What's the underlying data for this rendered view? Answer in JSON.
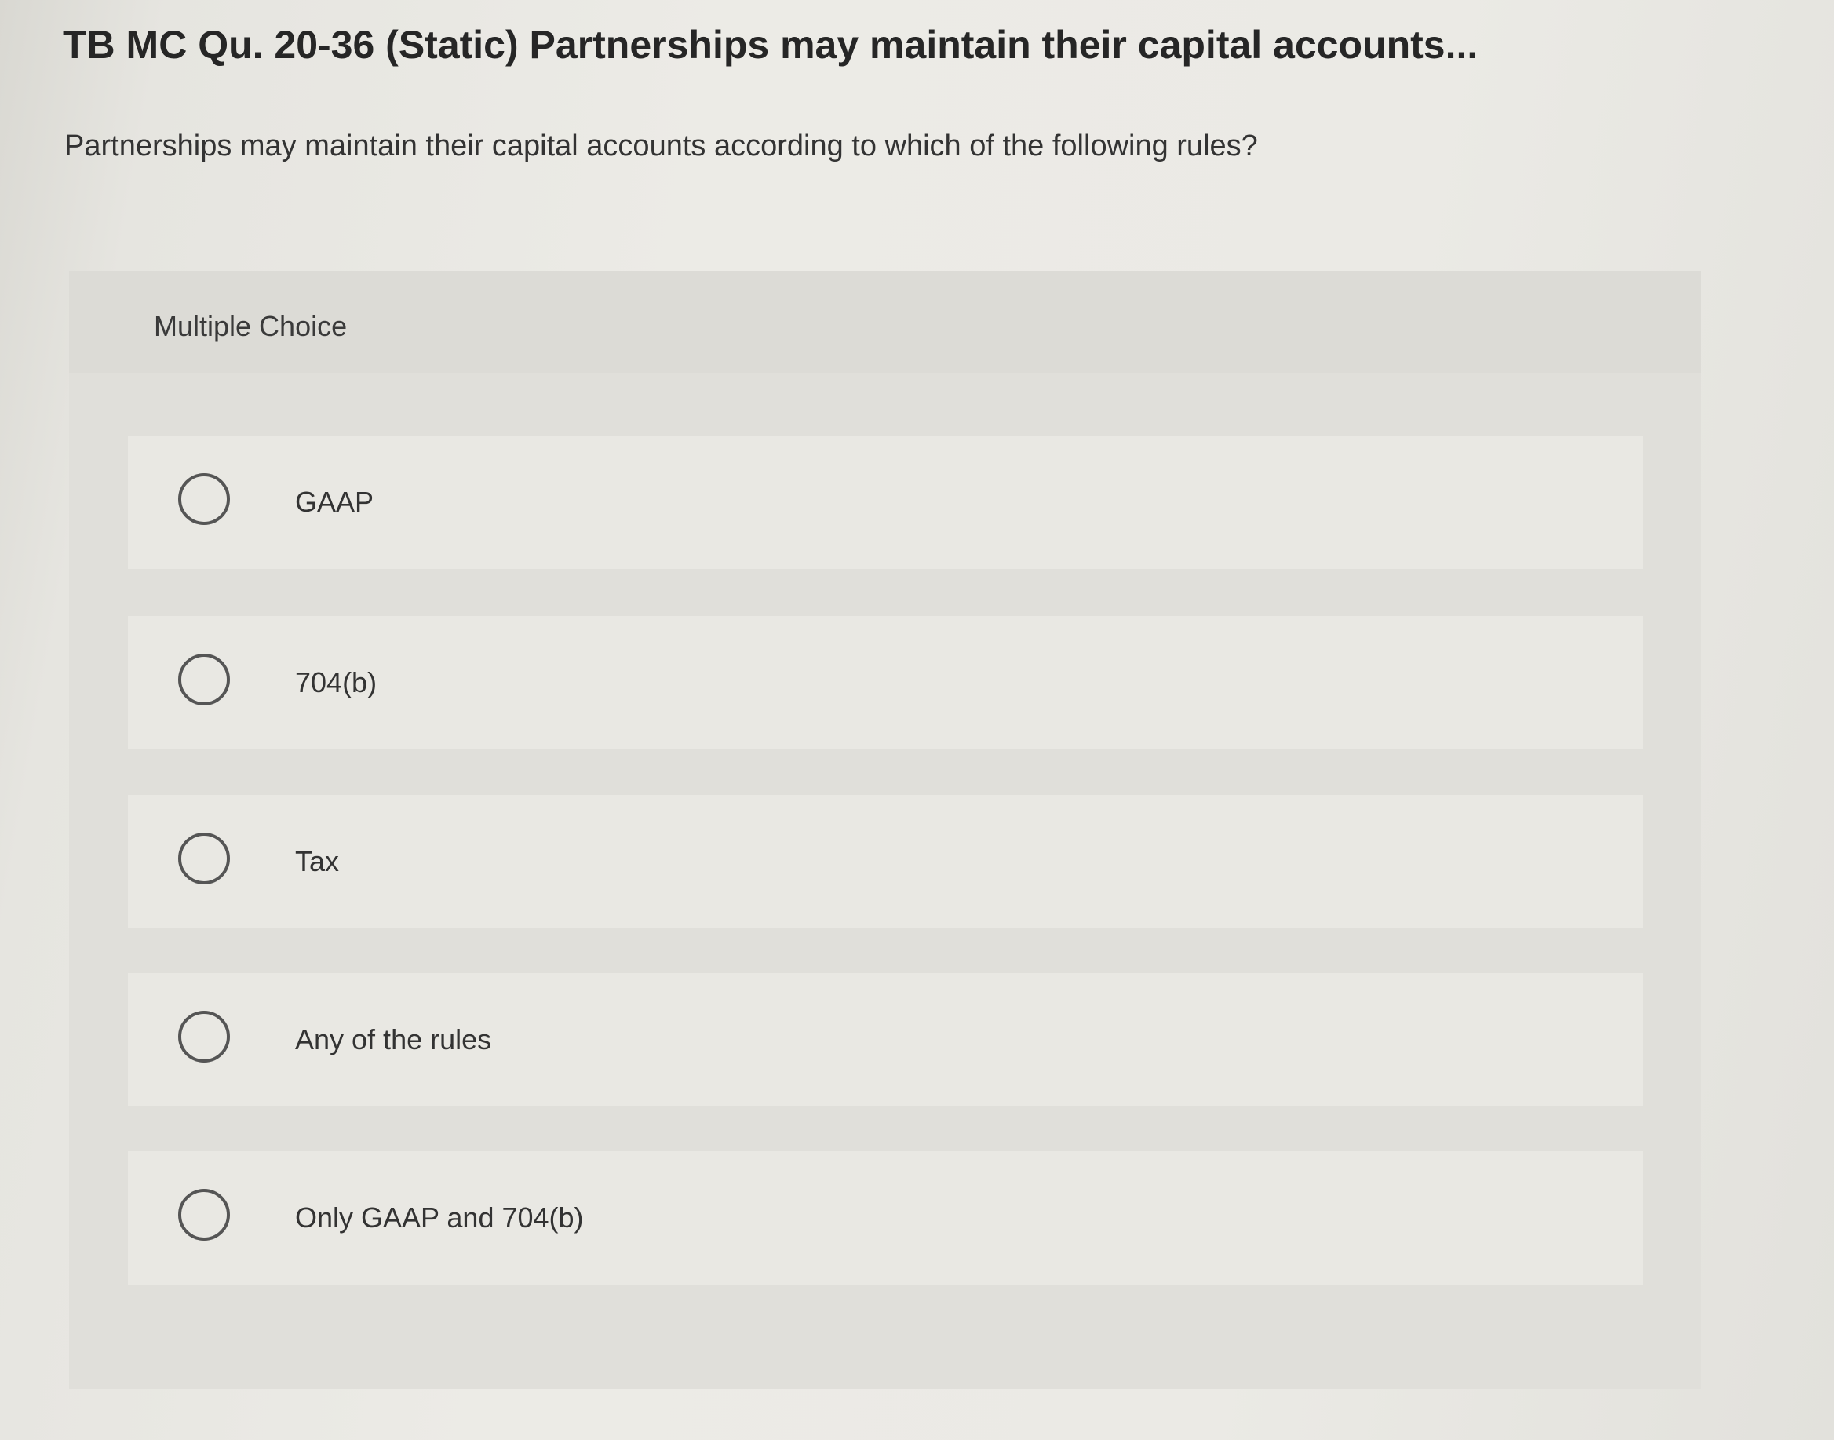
{
  "header": {
    "title": "TB MC Qu. 20-36 (Static) Partnerships may maintain their capital accounts..."
  },
  "question": {
    "text": "Partnerships may maintain their capital accounts according to which of the following rules?"
  },
  "multiple_choice": {
    "label": "Multiple Choice",
    "options": [
      {
        "label": "GAAP",
        "selected": false
      },
      {
        "label": "704(b)",
        "selected": false
      },
      {
        "label": "Tax",
        "selected": false
      },
      {
        "label": "Any of the rules",
        "selected": false
      },
      {
        "label": "Only GAAP and 704(b)",
        "selected": false
      }
    ]
  },
  "colors": {
    "text": "#2b2b2b",
    "panel": "#e0dfda",
    "option_bg": "#e9e8e3",
    "radio_border": "#555555"
  }
}
